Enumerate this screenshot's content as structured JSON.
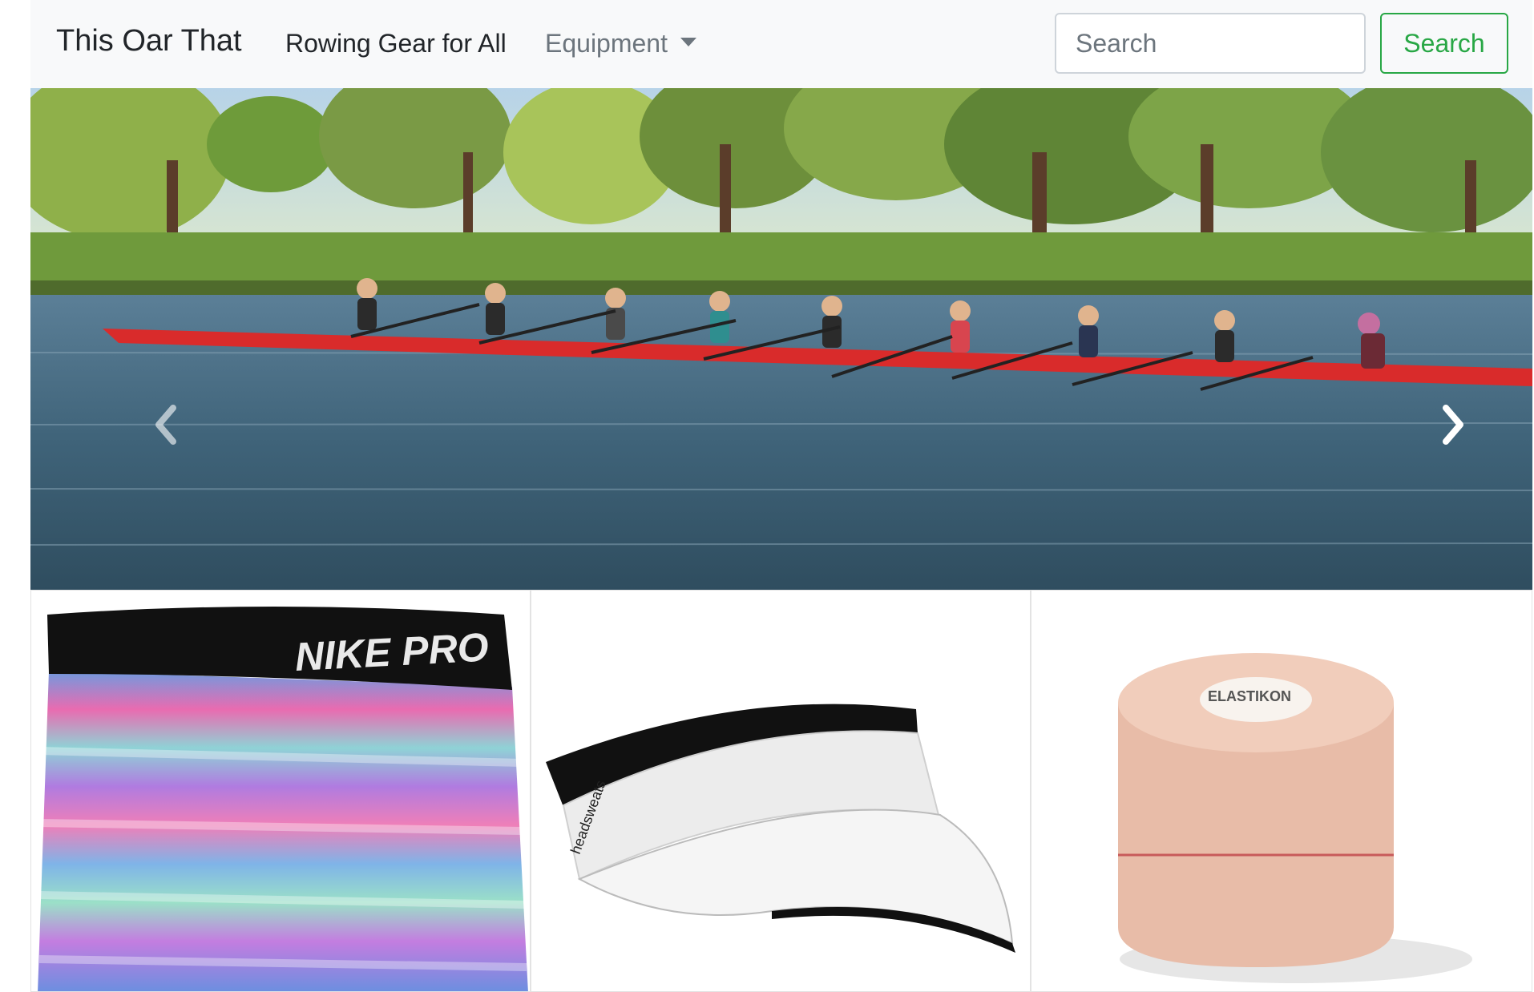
{
  "navbar": {
    "brand": "This Oar That",
    "nav_active": "Rowing Gear for All",
    "nav_dropdown": "Equipment",
    "search_placeholder": "Search",
    "search_button": "Search",
    "colors": {
      "background": "#f8f9fa",
      "success": "#28a745",
      "muted": "#6c757d"
    }
  },
  "carousel": {
    "image": "rowing-eight-on-river-photo",
    "prev_icon": "chevron-left-icon",
    "next_icon": "chevron-right-icon"
  },
  "products": [
    {
      "image": "nike-pro-shorts-photo",
      "brand_text": "NIKE PRO"
    },
    {
      "image": "white-visor-photo",
      "brand_text": "headsweats"
    },
    {
      "image": "athletic-tape-roll-photo",
      "brand_text": "ELASTIKON"
    }
  ]
}
